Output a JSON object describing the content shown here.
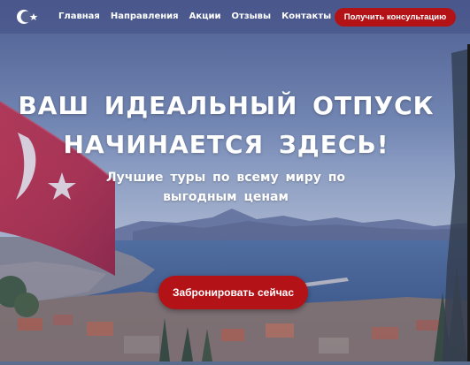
{
  "nav": {
    "links": [
      "Главная",
      "Направления",
      "Акции",
      "Отзывы",
      "Контакты"
    ],
    "cta_label": "Получить консультацию"
  },
  "hero": {
    "title_line1": "ВАШ ИДЕАЛЬНЫЙ ОТПУСК",
    "title_line2": "НАЧИНАЕТСЯ ЗДЕСЬ!",
    "subtitle_line1": "Лучшие туры по всему миру по",
    "subtitle_line2": "выгодным ценам",
    "button_label": "Забронировать сейчас"
  },
  "icons": {
    "logo": "crescent-star-icon"
  },
  "colors": {
    "accent": "#b31217",
    "nav_bg": "#46508766",
    "text": "#ffffff"
  }
}
